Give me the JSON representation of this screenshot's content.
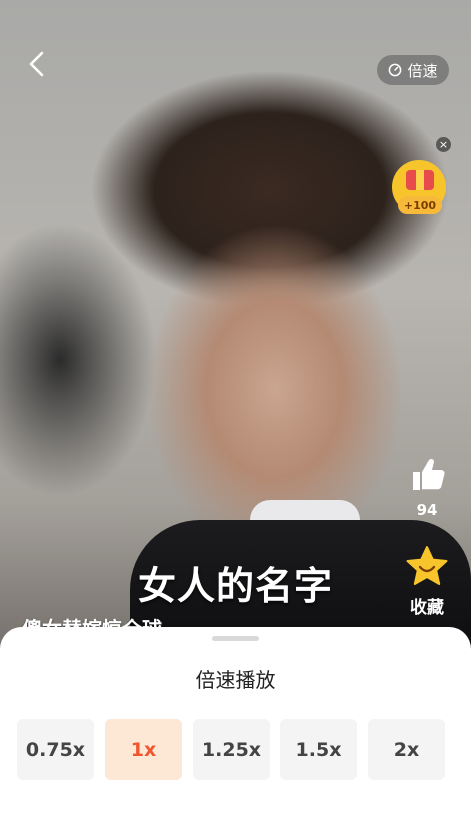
{
  "header": {
    "back_icon": "chevron-left-icon",
    "speed_label": "倍速",
    "speed_icon": "speed-gauge-icon"
  },
  "reward": {
    "badge": "+100",
    "close": "×"
  },
  "side_actions": {
    "like_count": "94",
    "favorite_label": "收藏"
  },
  "video": {
    "subtitle": "女人的名字",
    "title": "傻女替嫁惊全球"
  },
  "speed_sheet": {
    "title": "倍速播放",
    "options": [
      "0.75x",
      "1x",
      "1.25x",
      "1.5x",
      "2x"
    ],
    "selected": "1x"
  },
  "colors": {
    "accent": "#f0572e",
    "selected_bg": "#fde7d5",
    "option_bg": "#f4f4f4",
    "star": "#f7c42c"
  }
}
